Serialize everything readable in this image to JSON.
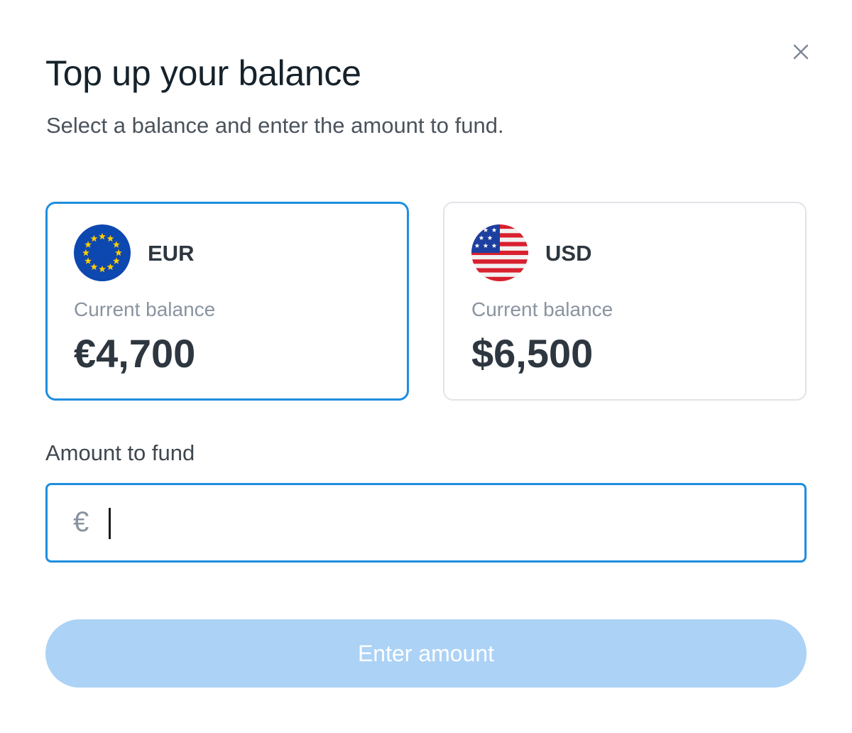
{
  "dialog": {
    "title": "Top up your balance",
    "subtitle": "Select a balance and enter the amount to fund."
  },
  "balances": [
    {
      "currency": "EUR",
      "flag_icon": "eu-flag-icon",
      "label": "Current balance",
      "amount": "€4,700",
      "selected": true
    },
    {
      "currency": "USD",
      "flag_icon": "us-flag-icon",
      "label": "Current balance",
      "amount": "$6,500",
      "selected": false
    }
  ],
  "amount_field": {
    "label": "Amount to fund",
    "currency_symbol": "€",
    "value": ""
  },
  "submit": {
    "label": "Enter amount",
    "disabled": true
  },
  "colors": {
    "accent": "#1e8ee0",
    "button_disabled": "#acd2f6",
    "eu_blue": "#0d47b0",
    "eu_star": "#ffce00",
    "us_red": "#d8202f",
    "us_blue": "#1d3fa0"
  }
}
